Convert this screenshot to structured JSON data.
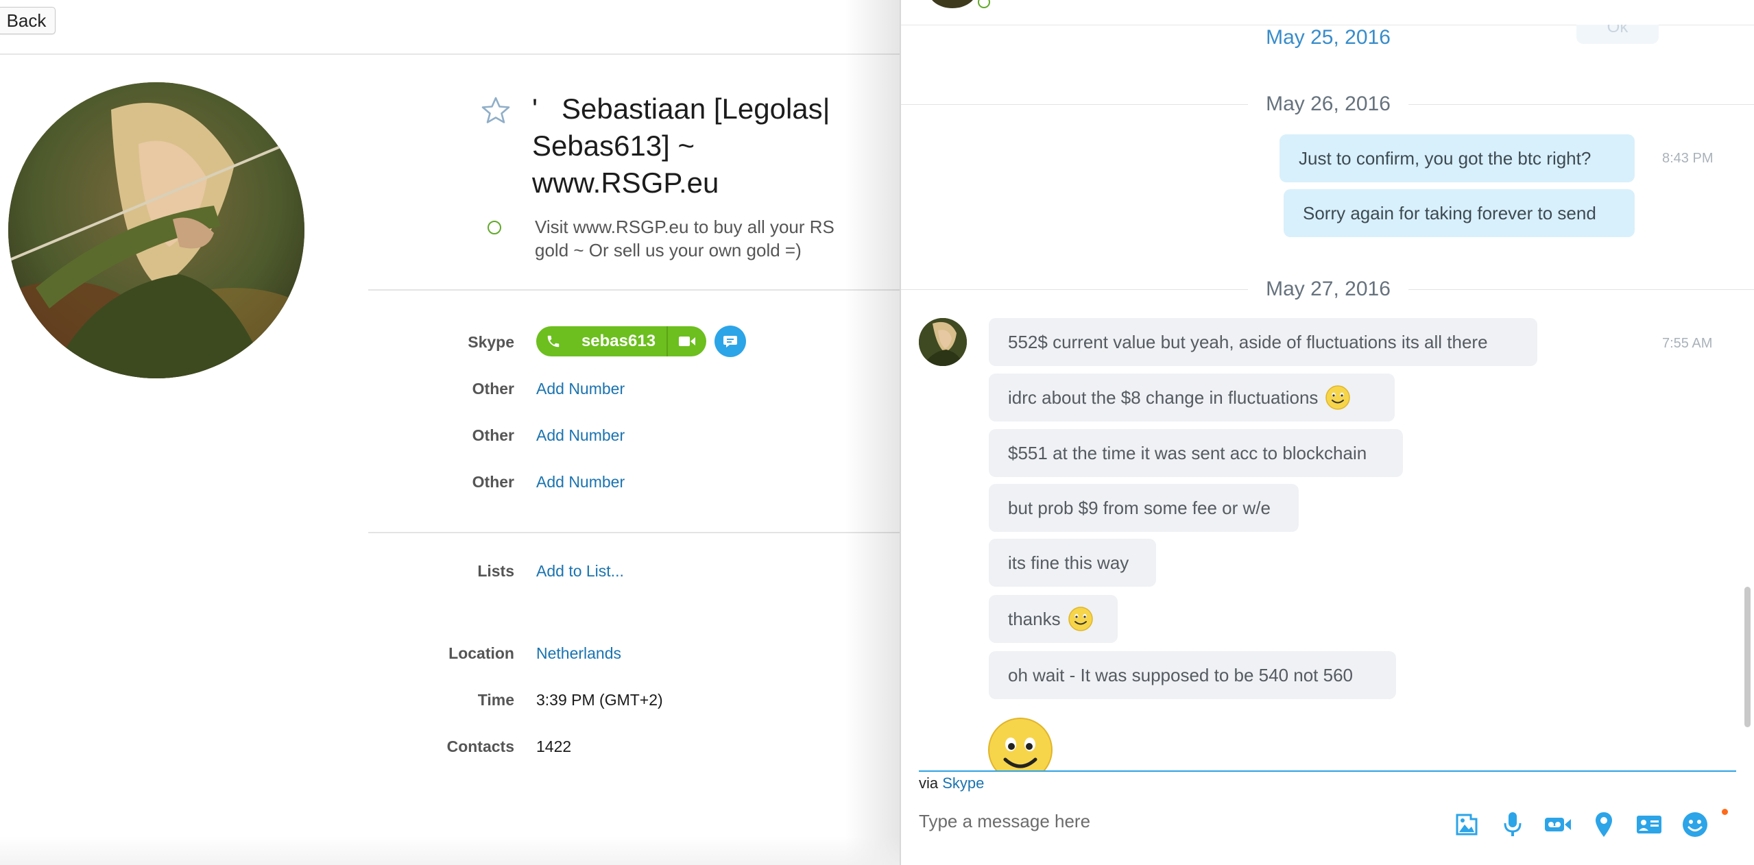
{
  "profile": {
    "back_label": "Back",
    "name": "'   Sebastiaan [Legolas| Sebas613] ~ www.RSGP.eu",
    "mood": "Visit www.RSGP.eu to buy all your RS gold ~ Or sell us your own gold =)",
    "skype_label": "Skype",
    "skype_handle": "sebas613",
    "phones": [
      {
        "label": "Other",
        "value": "Add Number"
      },
      {
        "label": "Other",
        "value": "Add Number"
      },
      {
        "label": "Other",
        "value": "Add Number"
      }
    ],
    "lists_label": "Lists",
    "lists_value": "Add to List...",
    "location_label": "Location",
    "location_value": "Netherlands",
    "time_label": "Time",
    "time_value": "3:39 PM (GMT+2)",
    "contacts_label": "Contacts",
    "contacts_value": "1422"
  },
  "chat": {
    "cut_date": "May 25, 2016",
    "cut_ghost": "Ok",
    "date_may26": "May 26, 2016",
    "outgoing": [
      "Just to confirm, you got the btc right?",
      "Sorry again for taking forever to send"
    ],
    "outgoing_time": "8:43 PM",
    "date_may27": "May 27, 2016",
    "incoming": [
      "552$ current value but yeah, aside of fluctuations its all there",
      "idrc about the $8 change in fluctuations",
      "$551 at the time it was sent acc to blockchain",
      "but prob $9 from some fee or w/e",
      "its fine this way",
      "thanks",
      "oh wait - It was supposed to be 540 not 560"
    ],
    "incoming_time": "7:55 AM",
    "via_prefix": "via",
    "via_link": "Skype",
    "compose_placeholder": "Type a message here"
  },
  "colors": {
    "skype_green": "#6cbf1e",
    "skype_blue": "#2ca4e8",
    "link_blue": "#1a73b0",
    "outgoing_bubble": "#d8f0fb",
    "incoming_bubble": "#eff1f4"
  },
  "icons": [
    "star-icon",
    "phone-icon",
    "video-icon",
    "chat-icon",
    "image-icon",
    "mic-icon",
    "video-message-icon",
    "location-icon",
    "contact-card-icon",
    "emoji-icon",
    "smile-emoji"
  ]
}
